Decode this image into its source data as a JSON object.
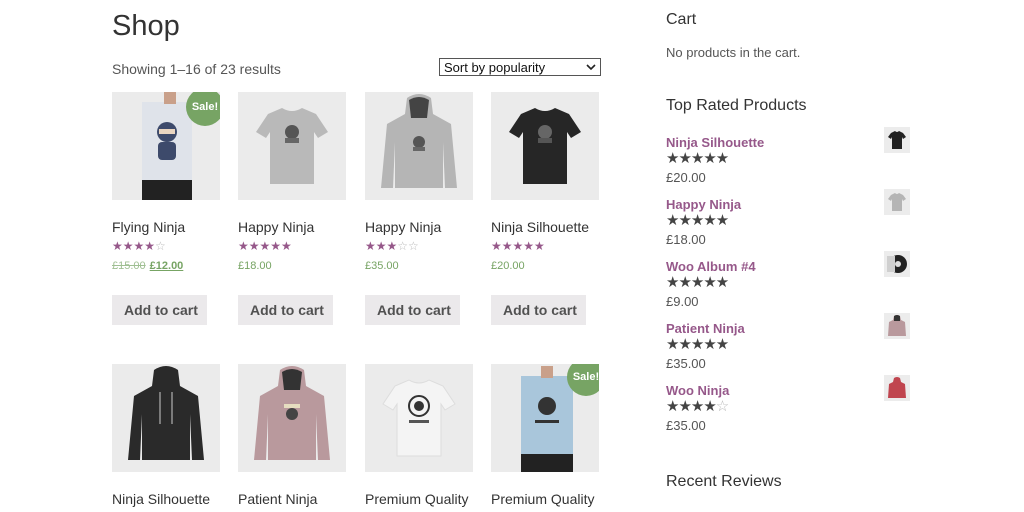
{
  "main": {
    "title": "Shop",
    "result_count": "Showing 1–16 of 23 results",
    "sort": {
      "selected": "Sort by popularity"
    }
  },
  "products": [
    {
      "name": "Flying Ninja",
      "rating": 4,
      "price_old": "£15.00",
      "price": "£12.00",
      "sale": "Sale!",
      "button": "Add to cart",
      "image": "poster-ninja"
    },
    {
      "name": "Happy Ninja",
      "rating": 5,
      "price": "£18.00",
      "button": "Add to cart",
      "image": "tshirt-grey"
    },
    {
      "name": "Happy Ninja",
      "rating": 3,
      "price": "£35.00",
      "button": "Add to cart",
      "image": "hoodie-grey"
    },
    {
      "name": "Ninja Silhouette",
      "rating": 5,
      "price": "£20.00",
      "button": "Add to cart",
      "image": "tshirt-black"
    },
    {
      "name": "Ninja Silhouette",
      "image": "hoodie-black"
    },
    {
      "name": "Patient Ninja",
      "image": "hoodie-pink"
    },
    {
      "name": "Premium Quality",
      "image": "tshirt-white"
    },
    {
      "name": "Premium Quality",
      "sale": "Sale!",
      "image": "poster-blue"
    }
  ],
  "sidebar": {
    "cart": {
      "title": "Cart",
      "empty_text": "No products in the cart."
    },
    "top_rated": {
      "title": "Top Rated Products",
      "items": [
        {
          "name": "Ninja Silhouette",
          "rating": 5,
          "price": "£20.00",
          "image": "tshirt-black"
        },
        {
          "name": "Happy Ninja",
          "rating": 5,
          "price": "£18.00",
          "image": "tshirt-grey"
        },
        {
          "name": "Woo Album #4",
          "rating": 5,
          "price": "£9.00",
          "image": "album"
        },
        {
          "name": "Patient Ninja",
          "rating": 5,
          "price": "£35.00",
          "image": "hoodie-pink"
        },
        {
          "name": "Woo Ninja",
          "rating": 4.5,
          "price": "£35.00",
          "image": "hoodie-red"
        }
      ]
    },
    "recent_reviews": {
      "title": "Recent Reviews"
    }
  },
  "colors": {
    "accent_purple": "#96588a",
    "price_green": "#77a464",
    "sale_badge": "#77a464",
    "button_bg": "#ebe9eb"
  }
}
